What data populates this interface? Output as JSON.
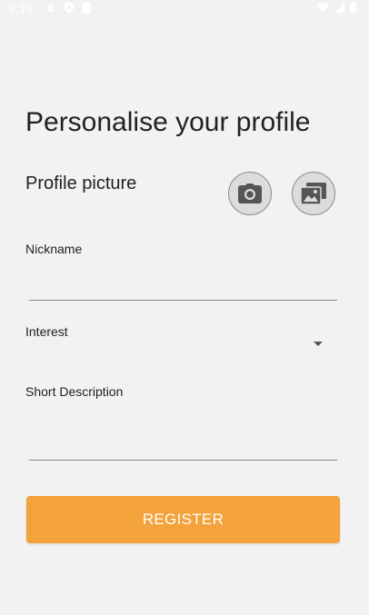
{
  "status_bar": {
    "time": "3:16",
    "left_icons": [
      "gear-icon",
      "shield-icon",
      "sd-card-icon"
    ],
    "right_icons": [
      "wifi-icon",
      "signal-icon",
      "battery-icon"
    ]
  },
  "page": {
    "title": "Personalise your profile"
  },
  "profile_picture": {
    "label": "Profile picture",
    "camera_icon": "camera-icon",
    "gallery_icon": "gallery-icon"
  },
  "form": {
    "nickname_label": "Nickname",
    "nickname_value": "",
    "interest_label": "Interest",
    "description_label": "Short Description",
    "description_value": ""
  },
  "actions": {
    "register_label": "REGISTER"
  },
  "colors": {
    "background": "#f2f2f2",
    "accent": "#f4a23c",
    "button_text": "#ffffff",
    "underline": "#8a8a8a"
  }
}
